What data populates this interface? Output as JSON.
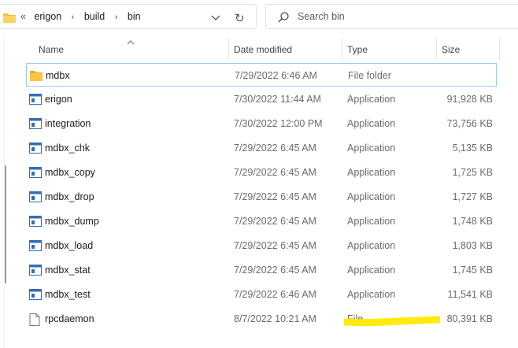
{
  "address": {
    "overflow": "«",
    "crumbs": [
      "erigon",
      "build",
      "bin"
    ],
    "icon": "folder-icon"
  },
  "search": {
    "placeholder": "Search bin",
    "icon": "search-icon"
  },
  "columns": {
    "name": "Name",
    "date": "Date modified",
    "type": "Type",
    "size": "Size"
  },
  "files": [
    {
      "name": "mdbx",
      "date": "7/29/2022 6:46 AM",
      "type": "File folder",
      "size": "",
      "icon": "folder-icon"
    },
    {
      "name": "erigon",
      "date": "7/30/2022 11:44 AM",
      "type": "Application",
      "size": "91,928 KB",
      "icon": "application-icon"
    },
    {
      "name": "integration",
      "date": "7/30/2022 12:00 PM",
      "type": "Application",
      "size": "73,756 KB",
      "icon": "application-icon"
    },
    {
      "name": "mdbx_chk",
      "date": "7/29/2022 6:45 AM",
      "type": "Application",
      "size": "5,135 KB",
      "icon": "application-icon"
    },
    {
      "name": "mdbx_copy",
      "date": "7/29/2022 6:45 AM",
      "type": "Application",
      "size": "1,725 KB",
      "icon": "application-icon"
    },
    {
      "name": "mdbx_drop",
      "date": "7/29/2022 6:45 AM",
      "type": "Application",
      "size": "1,727 KB",
      "icon": "application-icon"
    },
    {
      "name": "mdbx_dump",
      "date": "7/29/2022 6:45 AM",
      "type": "Application",
      "size": "1,748 KB",
      "icon": "application-icon"
    },
    {
      "name": "mdbx_load",
      "date": "7/29/2022 6:45 AM",
      "type": "Application",
      "size": "1,803 KB",
      "icon": "application-icon"
    },
    {
      "name": "mdbx_stat",
      "date": "7/29/2022 6:45 AM",
      "type": "Application",
      "size": "1,745 KB",
      "icon": "application-icon"
    },
    {
      "name": "mdbx_test",
      "date": "7/29/2022 6:46 AM",
      "type": "Application",
      "size": "11,541 KB",
      "icon": "application-icon"
    },
    {
      "name": "rpcdaemon",
      "date": "8/7/2022 10:21 AM",
      "type": "File",
      "size": "80,391 KB",
      "icon": "file-icon"
    }
  ],
  "colors": {
    "highlighter": "#ffea00",
    "selection_border": "#99c9ef",
    "folder": "#f5c242",
    "app_icon": "#2f6fb5"
  }
}
